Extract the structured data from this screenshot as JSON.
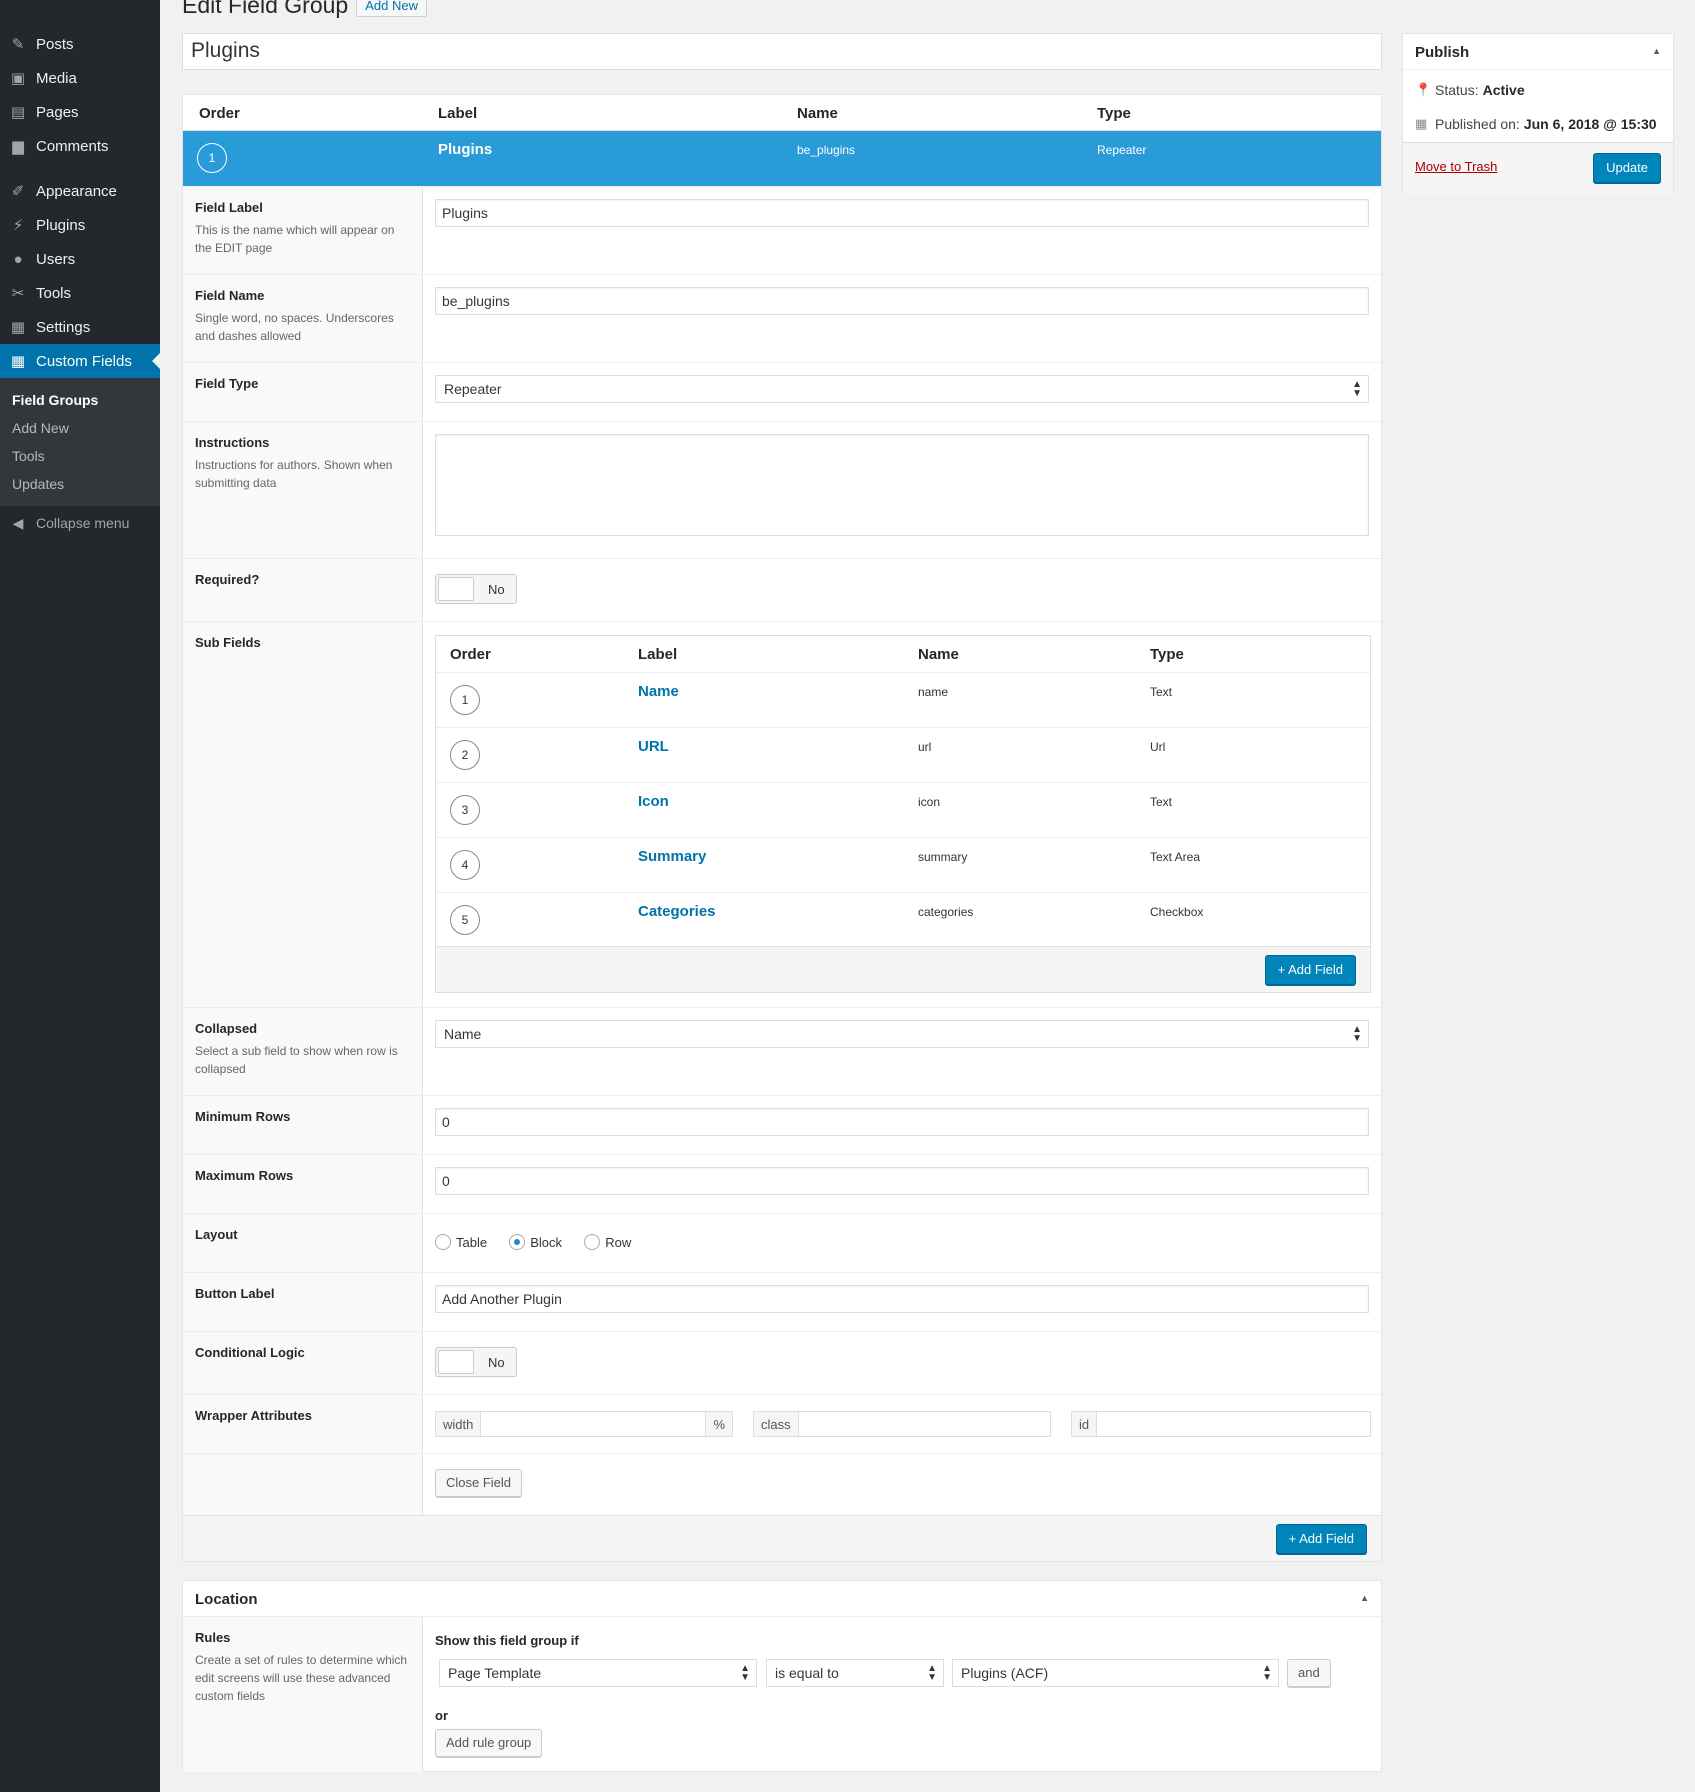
{
  "sidebar": {
    "items": [
      {
        "label": "Posts",
        "icon": "pin-icon"
      },
      {
        "label": "Media",
        "icon": "media-icon"
      },
      {
        "label": "Pages",
        "icon": "pages-icon"
      },
      {
        "label": "Comments",
        "icon": "comment-icon"
      },
      {
        "label": "Appearance",
        "icon": "paintbrush-icon"
      },
      {
        "label": "Plugins",
        "icon": "plugin-icon"
      },
      {
        "label": "Users",
        "icon": "user-icon"
      },
      {
        "label": "Tools",
        "icon": "wrench-icon"
      },
      {
        "label": "Settings",
        "icon": "settings-icon"
      },
      {
        "label": "Custom Fields",
        "icon": "custom-fields-icon"
      }
    ],
    "submenu": [
      "Field Groups",
      "Add New",
      "Tools",
      "Updates"
    ],
    "collapse_label": "Collapse menu"
  },
  "header": {
    "title": "Edit Field Group",
    "add_new": "Add New"
  },
  "field_group_title": "Plugins",
  "fields_table": {
    "headers": [
      "Order",
      "Label",
      "Name",
      "Type"
    ],
    "active_field": {
      "order": "1",
      "label": "Plugins",
      "name": "be_plugins",
      "type": "Repeater"
    }
  },
  "settings": {
    "field_label": {
      "title": "Field Label",
      "desc": "This is the name which will appear on the EDIT page",
      "value": "Plugins"
    },
    "field_name": {
      "title": "Field Name",
      "desc": "Single word, no spaces. Underscores and dashes allowed",
      "value": "be_plugins"
    },
    "field_type": {
      "title": "Field Type",
      "value": "Repeater"
    },
    "instructions": {
      "title": "Instructions",
      "desc": "Instructions for authors. Shown when submitting data",
      "value": ""
    },
    "required": {
      "title": "Required?",
      "value": "No"
    },
    "sub_fields": {
      "title": "Sub Fields",
      "headers": [
        "Order",
        "Label",
        "Name",
        "Type"
      ],
      "rows": [
        {
          "order": "1",
          "label": "Name",
          "name": "name",
          "type": "Text"
        },
        {
          "order": "2",
          "label": "URL",
          "name": "url",
          "type": "Url"
        },
        {
          "order": "3",
          "label": "Icon",
          "name": "icon",
          "type": "Text"
        },
        {
          "order": "4",
          "label": "Summary",
          "name": "summary",
          "type": "Text Area"
        },
        {
          "order": "5",
          "label": "Categories",
          "name": "categories",
          "type": "Checkbox"
        }
      ],
      "add_button": "+ Add Field"
    },
    "collapsed": {
      "title": "Collapsed",
      "desc": "Select a sub field to show when row is collapsed",
      "value": "Name"
    },
    "min_rows": {
      "title": "Minimum Rows",
      "value": "0"
    },
    "max_rows": {
      "title": "Maximum Rows",
      "value": "0"
    },
    "layout": {
      "title": "Layout",
      "options": [
        "Table",
        "Block",
        "Row"
      ],
      "selected": "Block"
    },
    "button_label": {
      "title": "Button Label",
      "value": "Add Another Plugin"
    },
    "conditional_logic": {
      "title": "Conditional Logic",
      "value": "No"
    },
    "wrapper": {
      "title": "Wrapper Attributes",
      "width_label": "width",
      "width_suffix": "%",
      "class_label": "class",
      "id_label": "id"
    },
    "close_button": "Close Field"
  },
  "add_field_button": "+ Add Field",
  "location": {
    "title": "Location",
    "rules_title": "Rules",
    "rules_desc": "Create a set of rules to determine which edit screens will use these advanced custom fields",
    "show_if": "Show this field group if",
    "param": "Page Template",
    "operator": "is equal to",
    "value": "Plugins (ACF)",
    "and_button": "and",
    "or_label": "or",
    "add_rule_group": "Add rule group"
  },
  "publish": {
    "title": "Publish",
    "status_label": "Status:",
    "status_value": "Active",
    "published_label": "Published on:",
    "published_value": "Jun 6, 2018 @ 15:30",
    "trash": "Move to Trash",
    "update": "Update"
  }
}
